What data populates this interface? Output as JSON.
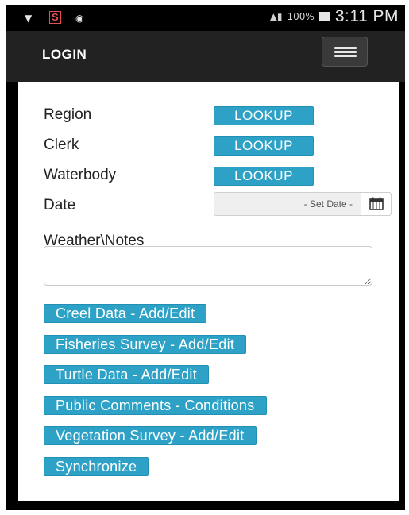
{
  "status_bar": {
    "icons": [
      "network-icon",
      "s-app-icon",
      "wifi-icon"
    ],
    "s_label": "S",
    "battery": "100%",
    "time": "3:11 PM"
  },
  "navbar": {
    "title": "LOGIN",
    "menu_icon": "hamburger-icon"
  },
  "form": {
    "region": {
      "label": "Region",
      "button": "LOOKUP"
    },
    "clerk": {
      "label": "Clerk",
      "button": "LOOKUP"
    },
    "waterbody": {
      "label": "Waterbody",
      "button": "LOOKUP"
    },
    "date": {
      "label": "Date",
      "placeholder": "- Set Date -",
      "icon": "calendar-icon"
    },
    "notes": {
      "label": "Weather\\Notes",
      "value": ""
    }
  },
  "actions": [
    {
      "label": "Creel Data - Add/Edit"
    },
    {
      "label": "Fisheries Survey - Add/Edit"
    },
    {
      "label": "Turtle Data - Add/Edit"
    },
    {
      "label": "Public Comments - Conditions"
    },
    {
      "label": "Vegetation Survey - Add/Edit"
    },
    {
      "label": "Synchronize"
    }
  ],
  "colors": {
    "button_bg": "#2ea2c6",
    "navbar_bg": "#222222"
  }
}
